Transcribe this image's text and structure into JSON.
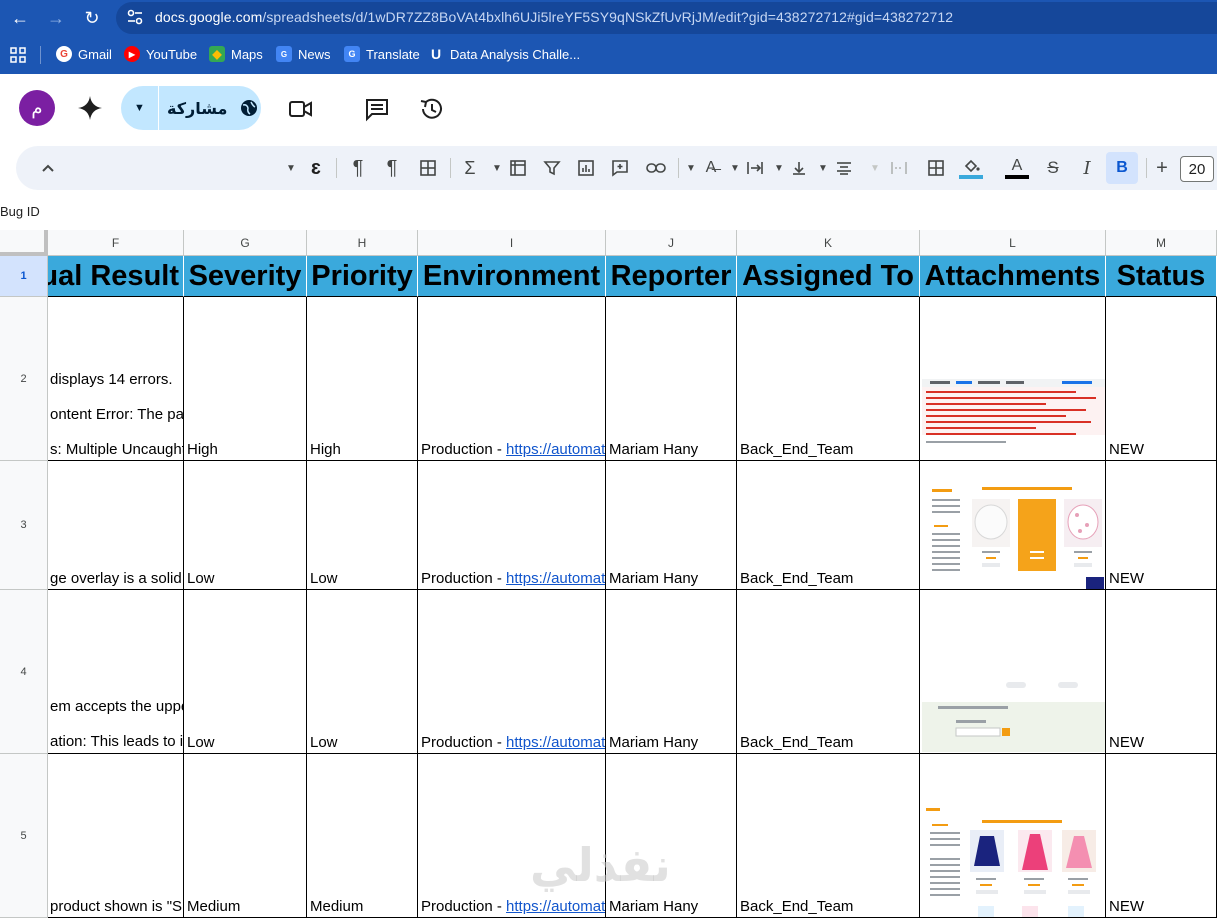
{
  "browser": {
    "url_host": "docs.google.com",
    "url_path": "/spreadsheets/d/1wDR7ZZ8BoVAt4bxlh6UJi5lreYF5SY9qNSkZfUvRjJM/edit?gid=438272712#gid=438272712",
    "bookmarks": [
      {
        "label": "Gmail",
        "icon": "gmail-icon",
        "color": "#ea4335"
      },
      {
        "label": "YouTube",
        "icon": "youtube-icon",
        "color": "#ff0000"
      },
      {
        "label": "Maps",
        "icon": "maps-icon",
        "color": "#34a853"
      },
      {
        "label": "News",
        "icon": "news-icon",
        "color": "#4285f4"
      },
      {
        "label": "Translate",
        "icon": "translate-icon",
        "color": "#4285f4"
      },
      {
        "label": "Data Analysis Challe...",
        "icon": "udacity-icon",
        "color": "#1a3aa6"
      }
    ]
  },
  "header": {
    "avatar_letter": "م",
    "share_label": "مشاركة"
  },
  "toolbar": {
    "font_size": "20",
    "bold_label": "B",
    "italic_label": "I",
    "sum_label": "Σ"
  },
  "name_box": "Bug ID",
  "columns": [
    "F",
    "G",
    "H",
    "I",
    "J",
    "K",
    "L",
    "M"
  ],
  "header_row": {
    "row_number": "1",
    "cells": [
      "ual Result",
      "Severity",
      "Priority",
      "Environment",
      "Reporter",
      "Assigned To",
      "Attachments",
      "Status"
    ]
  },
  "rows": [
    {
      "row_number": "2",
      "f_lines": [
        "displays 14 errors.",
        "ontent Error: The pag",
        "s: Multiple Uncaught"
      ],
      "severity": "High",
      "priority": "High",
      "env_prefix": "Production - ",
      "env_link": "https://automati",
      "reporter": "Mariam Hany",
      "assigned": "Back_End_Team",
      "status": "NEW"
    },
    {
      "row_number": "3",
      "f_lines": [
        "ge overlay is a solid"
      ],
      "severity": "Low",
      "priority": "Low",
      "env_prefix": "Production - ",
      "env_link": "https://automati",
      "reporter": "Mariam Hany",
      "assigned": "Back_End_Team",
      "status": "NEW"
    },
    {
      "row_number": "4",
      "f_lines": [
        "em accepts the uppe",
        "ation: This leads to in"
      ],
      "severity": "Low",
      "priority": "Low",
      "env_prefix": "Production - ",
      "env_link": "https://automati",
      "reporter": "Mariam Hany",
      "assigned": "Back_End_Team",
      "status": "NEW"
    },
    {
      "row_number": "5",
      "f_lines": [
        "product shown is \"Sl"
      ],
      "severity": "Medium",
      "priority": "Medium",
      "env_prefix": "Production - ",
      "env_link": "https://automati",
      "reporter": "Mariam Hany",
      "assigned": "Back_End_Team",
      "status": "NEW"
    }
  ],
  "watermark": "نفذلي"
}
